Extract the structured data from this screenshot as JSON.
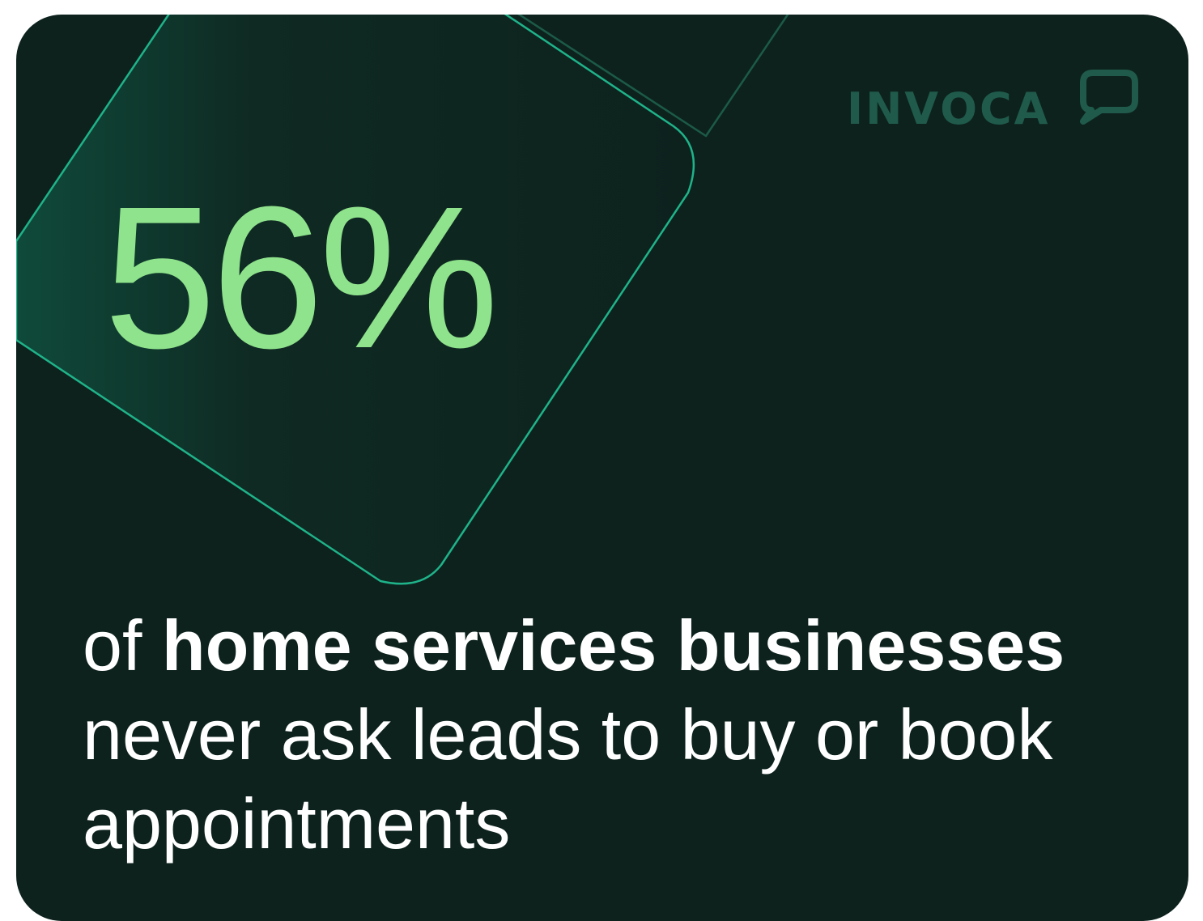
{
  "brand": {
    "logo_text": "INVOCA"
  },
  "stat": {
    "value": "56%"
  },
  "caption": {
    "prefix": "of ",
    "bold": "home services businesses",
    "rest_line1": "never ask leads to buy or book",
    "rest_line2": "appointments"
  },
  "colors": {
    "background": "#0d221d",
    "accent_green": "#8fe38c",
    "outline_teal": "#1fb38a",
    "logo": "#1f5a4a",
    "text": "#ffffff"
  }
}
